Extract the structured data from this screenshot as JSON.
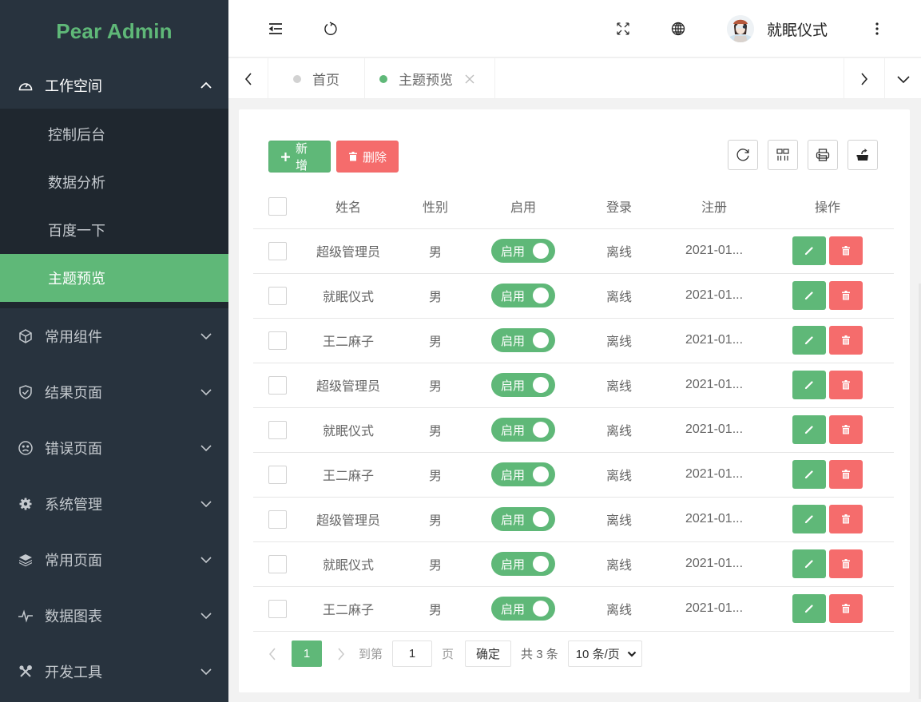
{
  "app": {
    "brand": "Pear Admin",
    "accent": "#5fb878",
    "danger": "#f56c6c"
  },
  "sidebar": {
    "groups": [
      {
        "label": "工作空间",
        "icon": "dashboard-icon",
        "expanded": true,
        "children": [
          {
            "label": "控制后台",
            "active": false
          },
          {
            "label": "数据分析",
            "active": false
          },
          {
            "label": "百度一下",
            "active": false
          },
          {
            "label": "主题预览",
            "active": true
          }
        ]
      },
      {
        "label": "常用组件",
        "icon": "cube-icon",
        "expanded": false
      },
      {
        "label": "结果页面",
        "icon": "shield-check-icon",
        "expanded": false
      },
      {
        "label": "错误页面",
        "icon": "sad-face-icon",
        "expanded": false
      },
      {
        "label": "系统管理",
        "icon": "gear-icon",
        "expanded": false
      },
      {
        "label": "常用页面",
        "icon": "layers-icon",
        "expanded": false
      },
      {
        "label": "数据图表",
        "icon": "pulse-icon",
        "expanded": false
      },
      {
        "label": "开发工具",
        "icon": "tools-icon",
        "expanded": false
      }
    ]
  },
  "header": {
    "icons": [
      "menu-collapse-icon",
      "refresh-icon",
      "fullscreen-icon",
      "globe-icon",
      "more-vertical-icon"
    ],
    "user": {
      "name": "就眠仪式",
      "avatar": "user-avatar"
    }
  },
  "tabs": {
    "items": [
      {
        "label": "首页",
        "active": false,
        "closable": false
      },
      {
        "label": "主题预览",
        "active": true,
        "closable": true
      }
    ]
  },
  "toolbar": {
    "add_label": "新增",
    "delete_label": "删除",
    "tools": [
      "refresh-icon",
      "columns-icon",
      "print-icon",
      "export-icon"
    ]
  },
  "table": {
    "columns": [
      "",
      "姓名",
      "性别",
      "启用",
      "登录",
      "注册",
      "操作"
    ],
    "rows": [
      {
        "name": "超级管理员",
        "gender": "男",
        "enabled": "启用",
        "login": "离线",
        "register": "2021-01..."
      },
      {
        "name": "就眠仪式",
        "gender": "男",
        "enabled": "启用",
        "login": "离线",
        "register": "2021-01..."
      },
      {
        "name": "王二麻子",
        "gender": "男",
        "enabled": "启用",
        "login": "离线",
        "register": "2021-01..."
      },
      {
        "name": "超级管理员",
        "gender": "男",
        "enabled": "启用",
        "login": "离线",
        "register": "2021-01..."
      },
      {
        "name": "就眠仪式",
        "gender": "男",
        "enabled": "启用",
        "login": "离线",
        "register": "2021-01..."
      },
      {
        "name": "王二麻子",
        "gender": "男",
        "enabled": "启用",
        "login": "离线",
        "register": "2021-01..."
      },
      {
        "name": "超级管理员",
        "gender": "男",
        "enabled": "启用",
        "login": "离线",
        "register": "2021-01..."
      },
      {
        "name": "就眠仪式",
        "gender": "男",
        "enabled": "启用",
        "login": "离线",
        "register": "2021-01..."
      },
      {
        "name": "王二麻子",
        "gender": "男",
        "enabled": "启用",
        "login": "离线",
        "register": "2021-01..."
      }
    ]
  },
  "pagination": {
    "current_page": "1",
    "goto_label": "到第",
    "goto_value": "1",
    "page_unit": "页",
    "confirm_label": "确定",
    "total_text": "共 3 条",
    "page_size": "10 条/页"
  }
}
